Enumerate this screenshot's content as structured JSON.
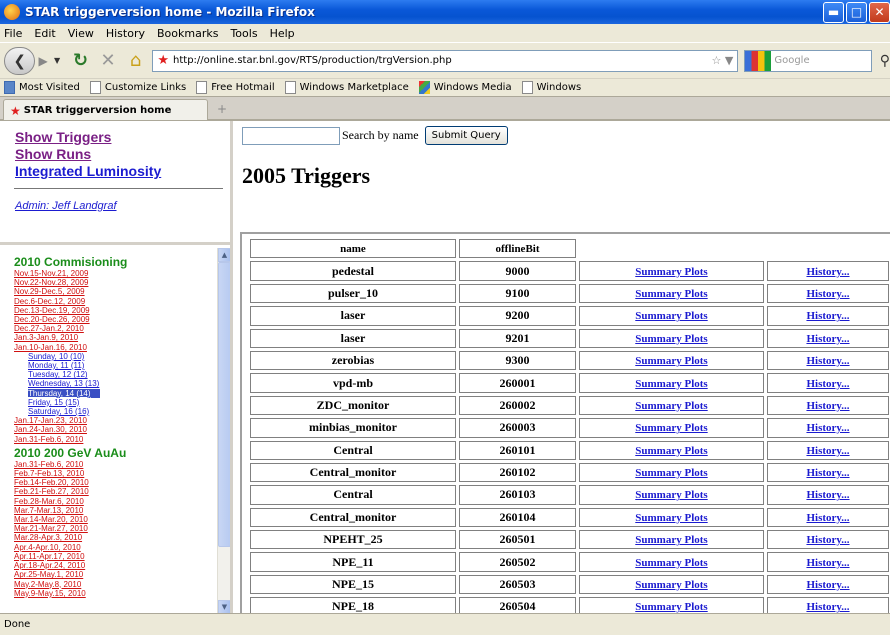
{
  "window": {
    "title": "STAR triggerversion home - Mozilla Firefox",
    "controls": [
      "minimize",
      "maximize",
      "close"
    ]
  },
  "menu": [
    "File",
    "Edit",
    "View",
    "History",
    "Bookmarks",
    "Tools",
    "Help"
  ],
  "nav": {
    "url": "http://online.star.bnl.gov/RTS/production/trgVersion.php",
    "search_placeholder": "Google"
  },
  "bookmarks": [
    "Most Visited",
    "Customize Links",
    "Free Hotmail",
    "Windows Marketplace",
    "Windows Media",
    "Windows"
  ],
  "tab": {
    "label": "STAR triggerversion home"
  },
  "left_nav": {
    "links": [
      "Show Triggers",
      "Show Runs",
      "Integrated Luminosity"
    ],
    "admin": "Admin: Jeff Landgraf"
  },
  "runs": {
    "section1": "2010 Commisioning",
    "weeks1": [
      "Nov.15-Nov.21, 2009",
      "Nov.22-Nov.28, 2009",
      "Nov.29-Dec.5, 2009",
      "Dec.6-Dec.12, 2009",
      "Dec.13-Dec.19, 2009",
      "Dec.20-Dec.26, 2009",
      "Dec.27-Jan.2, 2010",
      "Jan.3-Jan.9, 2010",
      "Jan.10-Jan.16, 2010"
    ],
    "days": [
      "Sunday, 10 (10)",
      "Monday, 11 (11)",
      "Tuesday, 12 (12)",
      "Wednesday, 13 (13)",
      "Thursday, 14 (14)",
      "Friday, 15 (15)",
      "Saturday, 16 (16)"
    ],
    "weeks1b": [
      "Jan.17-Jan.23, 2010",
      "Jan.24-Jan.30, 2010",
      "Jan.31-Feb.6, 2010"
    ],
    "section2": "2010 200 GeV AuAu",
    "weeks2": [
      "Jan.31-Feb.6, 2010",
      "Feb.7-Feb.13, 2010",
      "Feb.14-Feb.20, 2010",
      "Feb.21-Feb.27, 2010",
      "Feb.28-Mar.6, 2010",
      "Mar.7-Mar.13, 2010",
      "Mar.14-Mar.20, 2010",
      "Mar.21-Mar.27, 2010",
      "Mar.28-Apr.3, 2010",
      "Apr.4-Apr.10, 2010",
      "Apr.11-Apr.17, 2010",
      "Apr.18-Apr.24, 2010",
      "Apr.25-May.1, 2010",
      "May.2-May.8, 2010",
      "May.9-May.15, 2010"
    ]
  },
  "main": {
    "search_label": "Search by name",
    "submit_label": "Submit Query",
    "heading": "2005 Triggers",
    "col_name": "name",
    "col_bit": "offlineBit",
    "summary_label": "Summary Plots",
    "history_label": "History...",
    "rows": [
      {
        "name": "pedestal",
        "bit": "9000"
      },
      {
        "name": "pulser_10",
        "bit": "9100"
      },
      {
        "name": "laser",
        "bit": "9200"
      },
      {
        "name": "laser",
        "bit": "9201"
      },
      {
        "name": "zerobias",
        "bit": "9300"
      },
      {
        "name": "vpd-mb",
        "bit": "260001"
      },
      {
        "name": "ZDC_monitor",
        "bit": "260002"
      },
      {
        "name": "minbias_monitor",
        "bit": "260003"
      },
      {
        "name": "Central",
        "bit": "260101"
      },
      {
        "name": "Central_monitor",
        "bit": "260102"
      },
      {
        "name": "Central",
        "bit": "260103"
      },
      {
        "name": "Central_monitor",
        "bit": "260104"
      },
      {
        "name": "NPEHT_25",
        "bit": "260501"
      },
      {
        "name": "NPE_11",
        "bit": "260502"
      },
      {
        "name": "NPE_15",
        "bit": "260503"
      },
      {
        "name": "NPE_18",
        "bit": "260504"
      }
    ]
  },
  "status": "Done"
}
